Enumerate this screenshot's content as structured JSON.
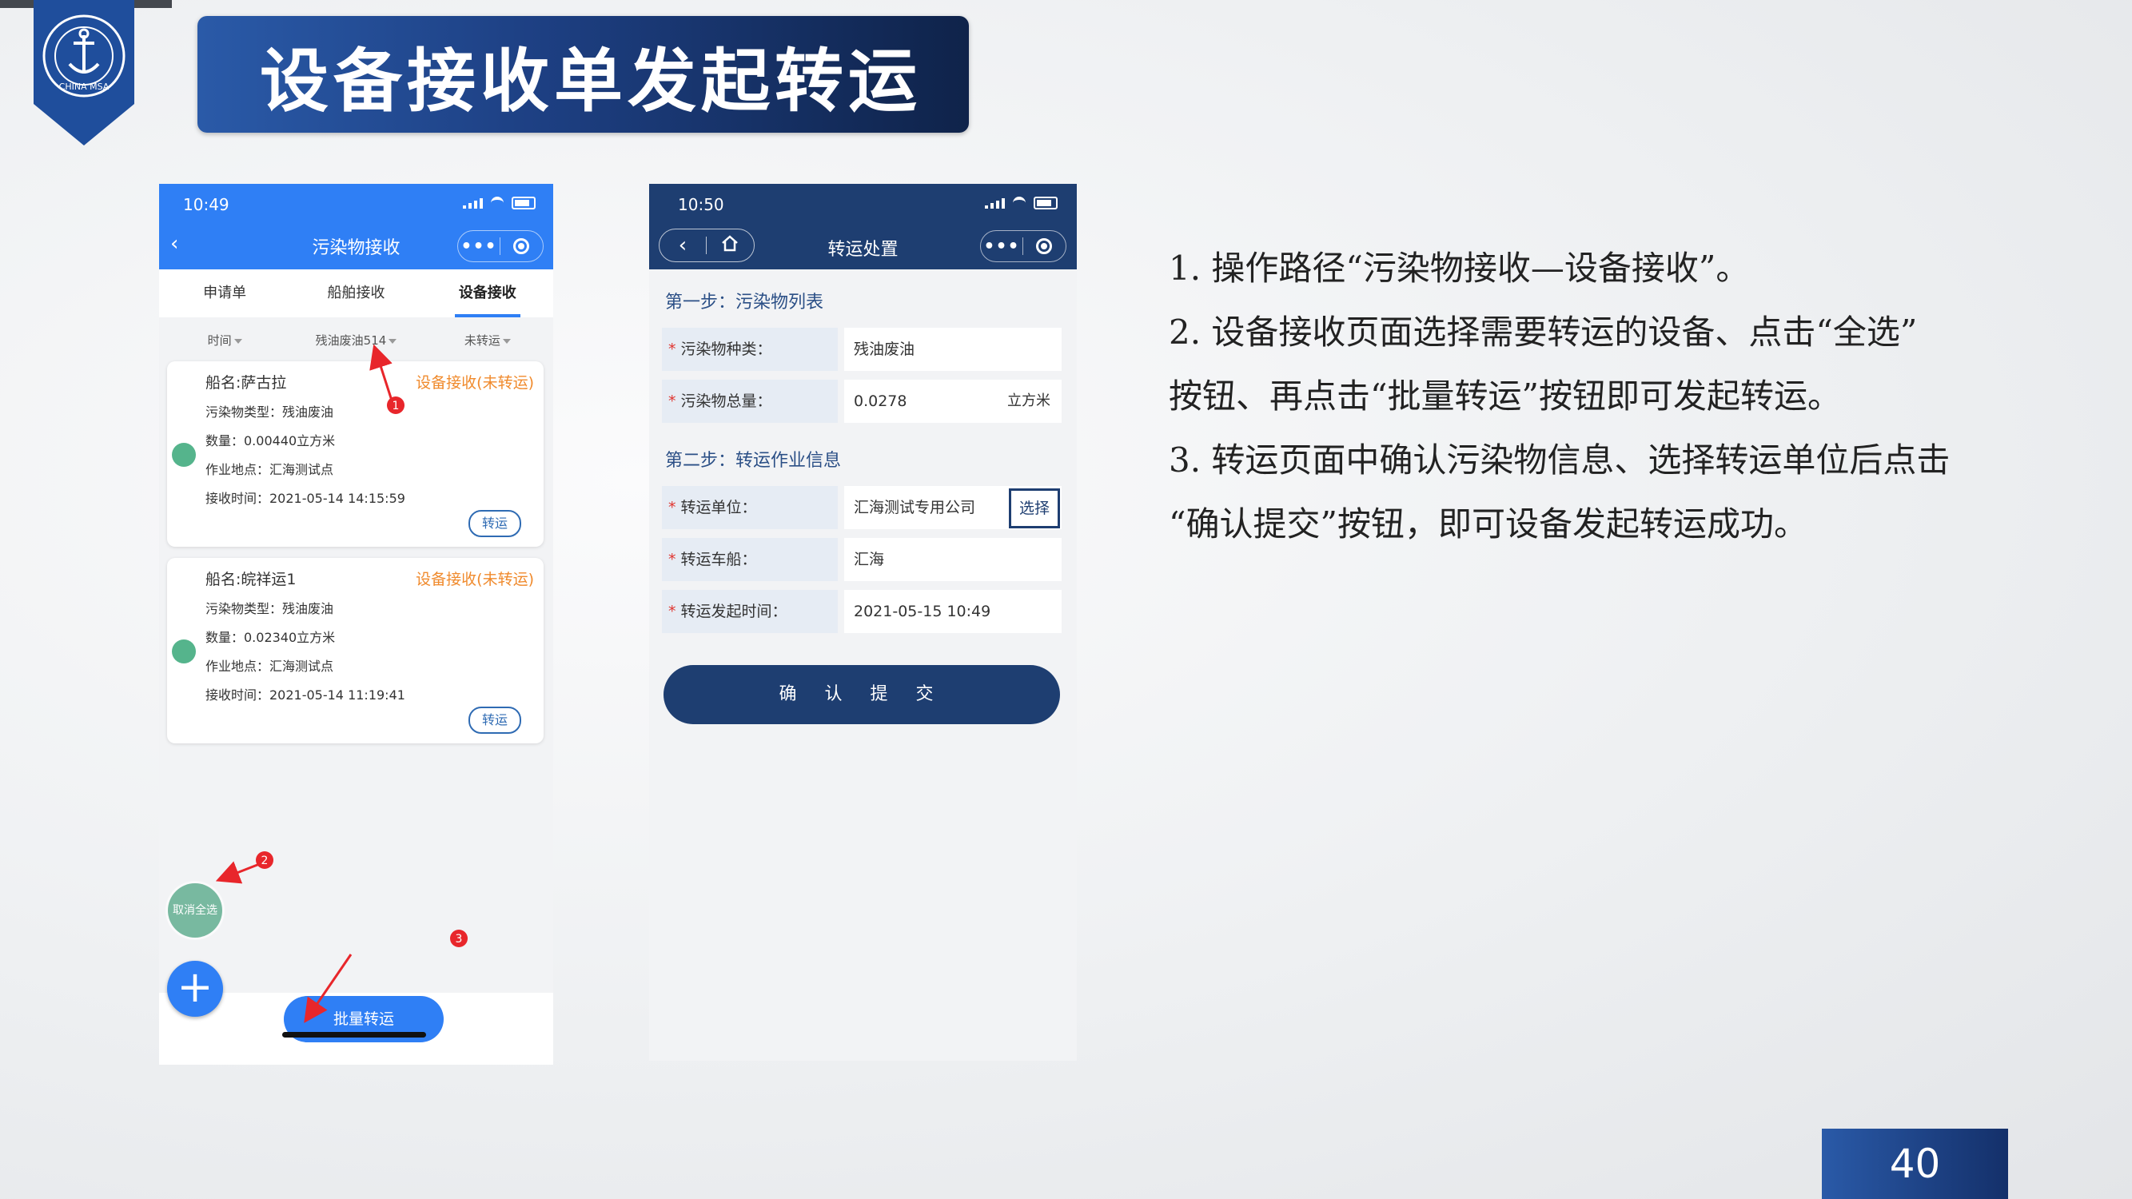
{
  "slide": {
    "title": "设备接收单发起转运",
    "page_number": "40",
    "accent_color": "#1d3f82"
  },
  "logo": {
    "icon": "anchor-emblem-icon",
    "text": "CHINA MSA"
  },
  "phone1": {
    "time": "10:49",
    "nav_title": "污染物接收",
    "tabs": [
      "申请单",
      "船舶接收",
      "设备接收"
    ],
    "active_tab": "设备接收",
    "filters": [
      "时间",
      "残油废油514",
      "未转运"
    ],
    "cards": [
      {
        "ship": "船名:萨古拉",
        "status": "设备接收(未转运)",
        "type": "污染物类型：残油废油",
        "quantity": "数量：0.00440立方米",
        "location": "作业地点：汇海测试点",
        "time": "接收时间：2021-05-14 14:15:59",
        "button": "转运"
      },
      {
        "ship": "船名:皖祥运1",
        "status": "设备接收(未转运)",
        "type": "污染物类型：残油废油",
        "quantity": "数量：0.02340立方米",
        "location": "作业地点：汇海测试点",
        "time": "接收时间：2021-05-14 11:19:41",
        "button": "转运"
      }
    ],
    "cancel_all": "取消全选",
    "add_icon": "plus-icon",
    "batch_button": "批量转运",
    "markers": [
      "1",
      "2",
      "3"
    ]
  },
  "phone2": {
    "time": "10:50",
    "nav_title": "转运处置",
    "step1": "第一步：污染物列表",
    "fields1": [
      {
        "label": "污染物种类：",
        "value": "残油废油",
        "unit": ""
      },
      {
        "label": "污染物总量：",
        "value": "0.0278",
        "unit": "立方米"
      }
    ],
    "step2": "第二步：转运作业信息",
    "fields2": [
      {
        "label": "转运单位：",
        "value": "汇海测试专用公司",
        "button": "选择"
      },
      {
        "label": "转运车船：",
        "value": "汇海"
      },
      {
        "label": "转运发起时间：",
        "value": "2021-05-15 10:49"
      }
    ],
    "submit": "确 认 提 交"
  },
  "instructions": {
    "line1": "1. 操作路径“污染物接收—设备接收”。",
    "line2a": "2. 设备接收页面选择需要转运的设备、点击“全选”",
    "line2b": "按钮、再点击“批量转运”按钮即可发起转运。",
    "line3a": "3. 转运页面中确认污染物信息、选择转运单位后点击",
    "line3b": "“确认提交”按钮，即可设备发起转运成功。"
  }
}
